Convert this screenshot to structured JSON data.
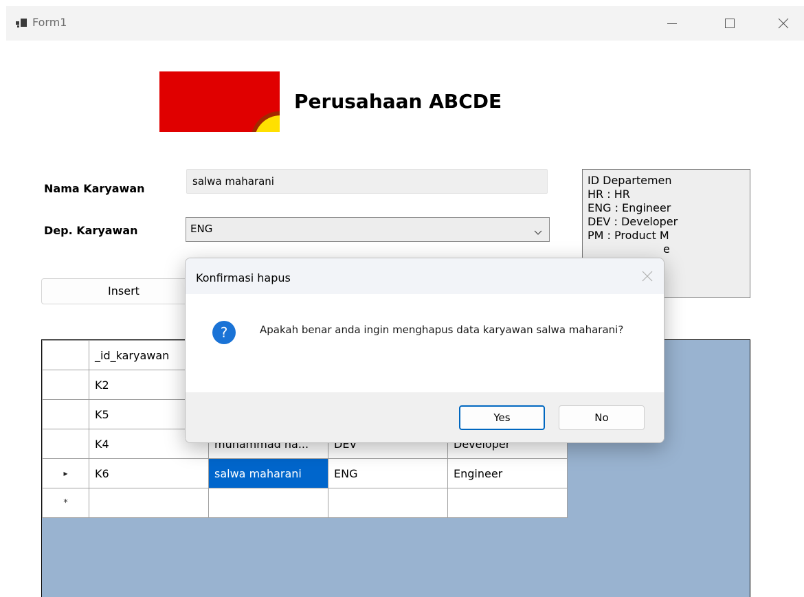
{
  "window": {
    "title": "Form1"
  },
  "header": {
    "company": "Perusahaan ABCDE"
  },
  "form": {
    "nama_label": "Nama Karyawan",
    "nama_value": "salwa maharani",
    "dep_label": "Dep. Karyawan",
    "dep_value": "ENG",
    "insert_label": "Insert"
  },
  "info": {
    "lines": [
      "ID Departemen",
      "HR : HR",
      "ENG : Engineer",
      "DEV : Developer",
      "PM : Product M",
      "e"
    ]
  },
  "grid": {
    "header": [
      "",
      "_id_karyawan",
      "",
      "",
      ""
    ],
    "rows": [
      [
        "",
        "K2",
        "",
        "",
        ""
      ],
      [
        "",
        "K5",
        "",
        "",
        ""
      ],
      [
        "",
        "K4",
        "muhammad na...",
        "DEV",
        "Developer"
      ],
      [
        "▸",
        "K6",
        "salwa maharani",
        "ENG",
        "Engineer"
      ],
      [
        "*",
        "",
        "",
        "",
        ""
      ]
    ]
  },
  "dialog": {
    "title": "Konfirmasi hapus",
    "message": "Apakah benar anda ingin menghapus data karyawan salwa maharani?",
    "yes_label": "Yes",
    "no_label": "No"
  },
  "colors": {
    "grid_background": "#99b3d0",
    "selection": "#0066cc",
    "logo_red": "#e00000",
    "logo_yellow": "#ffe000",
    "info_icon": "#1a73d6"
  }
}
